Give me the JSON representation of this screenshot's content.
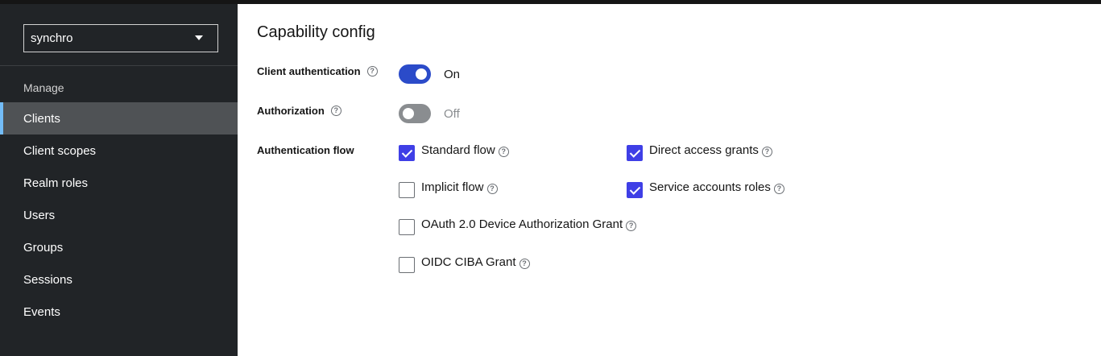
{
  "sidebar": {
    "realm_selector": {
      "value": "synchro"
    },
    "group_title": "Manage",
    "items": [
      {
        "label": "Clients",
        "active": true
      },
      {
        "label": "Client scopes",
        "active": false
      },
      {
        "label": "Realm roles",
        "active": false
      },
      {
        "label": "Users",
        "active": false
      },
      {
        "label": "Groups",
        "active": false
      },
      {
        "label": "Sessions",
        "active": false
      },
      {
        "label": "Events",
        "active": false
      }
    ]
  },
  "main": {
    "section_title": "Capability config",
    "client_authentication": {
      "label": "Client authentication",
      "state_text": "On",
      "enabled": true
    },
    "authorization": {
      "label": "Authorization",
      "state_text": "Off",
      "enabled": false
    },
    "authentication_flow": {
      "label": "Authentication flow",
      "options": [
        {
          "label": "Standard flow",
          "checked": true
        },
        {
          "label": "Direct access grants",
          "checked": true
        },
        {
          "label": "Implicit flow",
          "checked": false
        },
        {
          "label": "Service accounts roles",
          "checked": true
        },
        {
          "label": "OAuth 2.0 Device Authorization Grant",
          "checked": false
        },
        {
          "label": "OIDC CIBA Grant",
          "checked": false
        }
      ]
    }
  },
  "colors": {
    "sidebar_bg": "#212427",
    "active_nav_bg": "#4f5255",
    "active_nav_accent": "#73bcf7",
    "switch_on": "#2b4bc9",
    "switch_off": "#8a8d90",
    "checkbox_checked": "#3f3fe6"
  },
  "icons": {
    "help": "question-circle-icon",
    "dropdown": "caret-down-icon"
  }
}
